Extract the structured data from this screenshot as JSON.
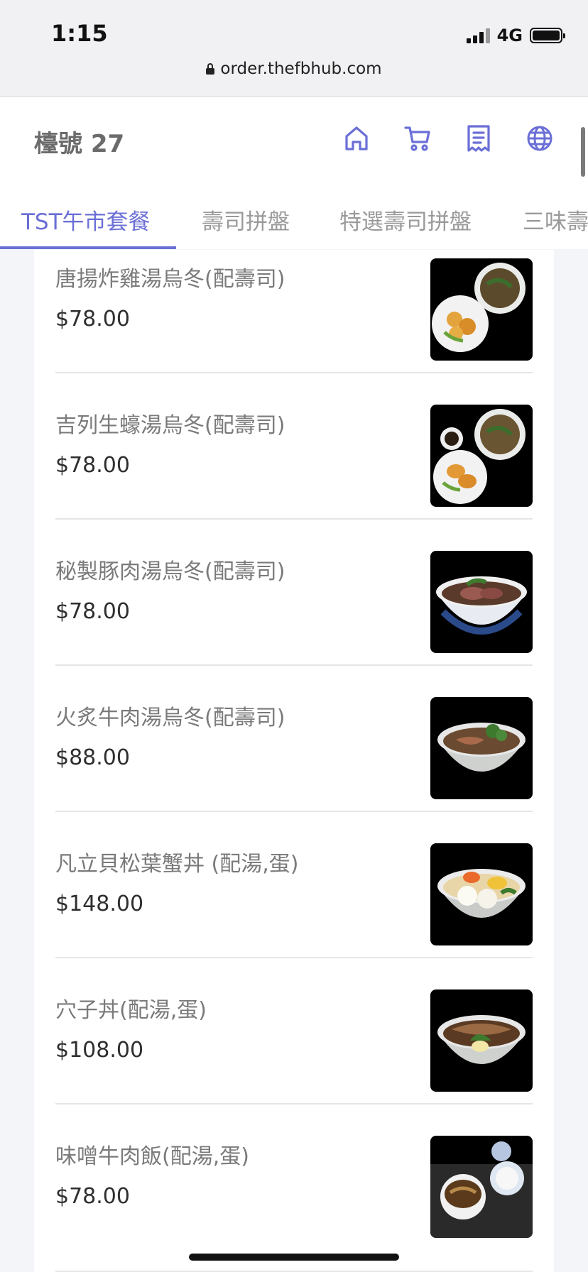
{
  "status_bar": {
    "time": "1:15",
    "network": "4G",
    "url": "order.thefbhub.com"
  },
  "header": {
    "table_label": "檯號 27",
    "icons": [
      "home-icon",
      "cart-icon",
      "receipt-icon",
      "globe-icon"
    ],
    "accent_color": "#6b6fd6"
  },
  "tabs": [
    {
      "label": "TST午市套餐",
      "active": true
    },
    {
      "label": "壽司拼盤",
      "active": false
    },
    {
      "label": "特選壽司拼盤",
      "active": false
    },
    {
      "label": "三味壽",
      "active": false
    }
  ],
  "menu": {
    "items": [
      {
        "name": "唐揚炸雞湯烏冬(配壽司)",
        "price": "$78.00"
      },
      {
        "name": "吉列生蠔湯烏冬(配壽司)",
        "price": "$78.00"
      },
      {
        "name": "秘製豚肉湯烏冬(配壽司)",
        "price": "$78.00"
      },
      {
        "name": "火炙牛肉湯烏冬(配壽司)",
        "price": "$88.00"
      },
      {
        "name": "凡立貝松葉蟹丼 (配湯,蛋)",
        "price": "$148.00"
      },
      {
        "name": "穴子丼(配湯,蛋)",
        "price": "$108.00"
      },
      {
        "name": "味噌牛肉飯(配湯,蛋)",
        "price": "$78.00"
      }
    ]
  }
}
